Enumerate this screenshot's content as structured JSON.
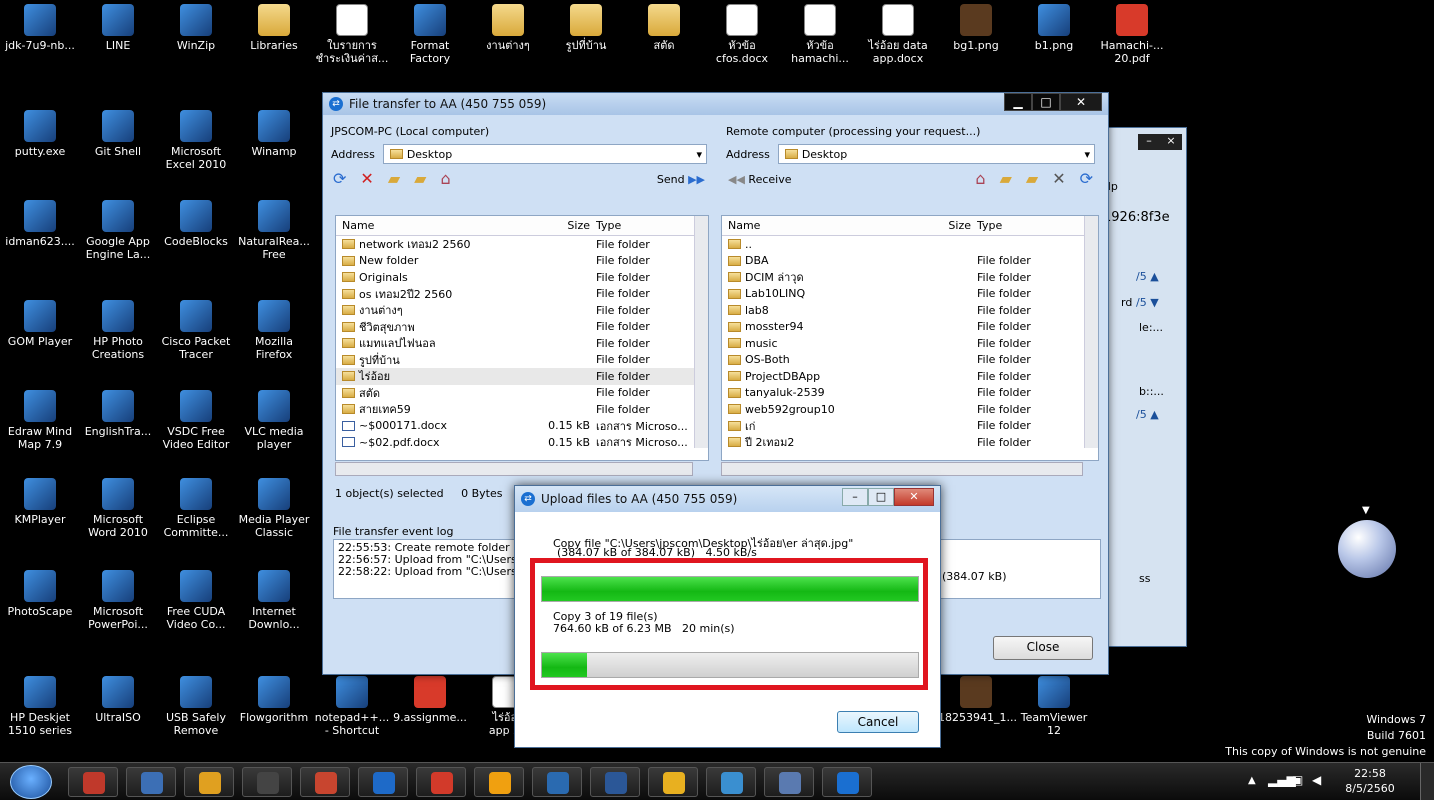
{
  "desktop_icons": [
    {
      "label": "jdk-7u9-nb...",
      "icon": "jdk-installer-icon",
      "kind": "app"
    },
    {
      "label": "LINE",
      "icon": "line-icon",
      "kind": "app"
    },
    {
      "label": "WinZip",
      "icon": "winzip-icon",
      "kind": "app"
    },
    {
      "label": "Libraries",
      "icon": "libraries-icon",
      "kind": "folder"
    },
    {
      "label": "ใบรายการ\nชำระเงินค่าส...",
      "icon": "document-shortcut-icon",
      "kind": "doc"
    },
    {
      "label": "Format\nFactory",
      "icon": "format-factory-icon",
      "kind": "app"
    },
    {
      "label": "งานต่างๆ",
      "icon": "folder-icon",
      "kind": "folder"
    },
    {
      "label": "รูปที่บ้าน",
      "icon": "folder-icon",
      "kind": "folder"
    },
    {
      "label": "สตัด",
      "icon": "folder-icon",
      "kind": "folder"
    },
    {
      "label": "หัวข้อ\ncfos.docx",
      "icon": "word-doc-icon",
      "kind": "doc"
    },
    {
      "label": "หัวข้อ\nhamachi...",
      "icon": "word-doc-icon",
      "kind": "doc"
    },
    {
      "label": "ไร่อ้อย data\napp.docx",
      "icon": "word-doc-icon",
      "kind": "doc"
    },
    {
      "label": "bg1.png",
      "icon": "image-file-icon",
      "kind": "img"
    },
    {
      "label": "b1.png",
      "icon": "image-file-icon",
      "kind": "app"
    },
    {
      "label": "Hamachi-...\n20.pdf",
      "icon": "pdf-file-icon",
      "kind": "pdf"
    },
    {
      "label": "putty.exe",
      "icon": "putty-icon",
      "kind": "app"
    },
    {
      "label": "Git Shell",
      "icon": "git-shell-icon",
      "kind": "app"
    },
    {
      "label": "Microsoft\nExcel 2010",
      "icon": "excel-icon",
      "kind": "app"
    },
    {
      "label": "Winamp",
      "icon": "winamp-icon",
      "kind": "app"
    },
    {
      "label": "idman623....",
      "icon": "idm-icon",
      "kind": "app"
    },
    {
      "label": "Google App\nEngine La...",
      "icon": "google-app-engine-icon",
      "kind": "app"
    },
    {
      "label": "CodeBlocks",
      "icon": "codeblocks-icon",
      "kind": "app"
    },
    {
      "label": "NaturalRea...\nFree",
      "icon": "naturalreader-icon",
      "kind": "app"
    },
    {
      "label": "GOM Player",
      "icon": "gom-player-icon",
      "kind": "app"
    },
    {
      "label": "HP Photo\nCreations",
      "icon": "hp-photo-icon",
      "kind": "app"
    },
    {
      "label": "Cisco Packet\nTracer",
      "icon": "cisco-packet-tracer-icon",
      "kind": "app"
    },
    {
      "label": "Mozilla\nFirefox",
      "icon": "firefox-icon",
      "kind": "app"
    },
    {
      "label": "Edraw Mind\nMap 7.9",
      "icon": "edraw-icon",
      "kind": "app"
    },
    {
      "label": "EnglishTra...",
      "icon": "englishtranslator-icon",
      "kind": "app"
    },
    {
      "label": "VSDC Free\nVideo Editor",
      "icon": "vsdc-icon",
      "kind": "app"
    },
    {
      "label": "VLC media\nplayer",
      "icon": "vlc-icon",
      "kind": "app"
    },
    {
      "label": "KMPlayer",
      "icon": "kmplayer-icon",
      "kind": "app"
    },
    {
      "label": "Microsoft\nWord 2010",
      "icon": "word-icon",
      "kind": "app"
    },
    {
      "label": "Eclipse\nCommitte...",
      "icon": "eclipse-icon",
      "kind": "app"
    },
    {
      "label": "Media Player\nClassic",
      "icon": "media-player-classic-icon",
      "kind": "app"
    },
    {
      "label": "PhotoScape",
      "icon": "photoscape-icon",
      "kind": "app"
    },
    {
      "label": "Microsoft\nPowerPoi...",
      "icon": "powerpoint-icon",
      "kind": "app"
    },
    {
      "label": "Free CUDA\nVideo Co...",
      "icon": "cuda-video-icon",
      "kind": "app"
    },
    {
      "label": "Internet\nDownlo...",
      "icon": "internet-download-icon",
      "kind": "app"
    },
    {
      "label": "HP Deskjet\n1510 series",
      "icon": "printer-icon",
      "kind": "app"
    },
    {
      "label": "UltraISO",
      "icon": "ultraiso-icon",
      "kind": "app"
    },
    {
      "label": "USB Safely\nRemove",
      "icon": "usb-icon",
      "kind": "app"
    },
    {
      "label": "Flowgorithm",
      "icon": "flowgorithm-icon",
      "kind": "app"
    },
    {
      "label": "notepad++...\n- Shortcut",
      "icon": "notepadpp-icon",
      "kind": "app"
    },
    {
      "label": "9.assignme...",
      "icon": "pdf-file-icon",
      "kind": "pdf"
    },
    {
      "label": "ไร่อ้อย\napp 25",
      "icon": "word-doc-icon",
      "kind": "doc"
    },
    {
      "label": "18253941_1...",
      "icon": "image-file-icon",
      "kind": "img"
    },
    {
      "label": "TeamViewer\n12",
      "icon": "teamviewer-icon",
      "kind": "app"
    }
  ],
  "file_transfer": {
    "title": "File transfer to AA (450 755 059)",
    "local": {
      "heading": "JPSCOM-PC (Local computer)",
      "address_label": "Address",
      "address_value": "Desktop",
      "send_label": "Send",
      "col_name": "Name",
      "col_size": "Size",
      "col_type": "Type",
      "files": [
        {
          "name": "network เทอม2 2560",
          "size": "",
          "type": "File folder"
        },
        {
          "name": "New folder",
          "size": "",
          "type": "File folder"
        },
        {
          "name": "Originals",
          "size": "",
          "type": "File folder"
        },
        {
          "name": "os เทอม2ปี2  2560",
          "size": "",
          "type": "File folder"
        },
        {
          "name": "งานต่างๆ",
          "size": "",
          "type": "File folder"
        },
        {
          "name": "ชีวิตสุขภาพ",
          "size": "",
          "type": "File folder"
        },
        {
          "name": "แมทแลปไฟนอล",
          "size": "",
          "type": "File folder"
        },
        {
          "name": "รูปที่บ้าน",
          "size": "",
          "type": "File folder"
        },
        {
          "name": "ไร่อ้อย",
          "size": "",
          "type": "File folder"
        },
        {
          "name": "สตัด",
          "size": "",
          "type": "File folder"
        },
        {
          "name": "สายเทค59",
          "size": "",
          "type": "File folder"
        },
        {
          "name": "~$000171.docx",
          "size": "0.15 kB",
          "type": "เอกสาร Microso..."
        },
        {
          "name": "~$02.pdf.docx",
          "size": "0.15 kB",
          "type": "เอกสาร Microso..."
        }
      ],
      "status": "1 object(s) selected     0 Bytes"
    },
    "remote": {
      "heading": "Remote computer (processing your request...)",
      "address_label": "Address",
      "address_value": "Desktop",
      "receive_label": "Receive",
      "col_name": "Name",
      "col_size": "Size",
      "col_type": "Type",
      "files": [
        {
          "name": "..",
          "size": "",
          "type": ""
        },
        {
          "name": "DBA",
          "size": "",
          "type": "File folder"
        },
        {
          "name": "DCIM ล่าวุด",
          "size": "",
          "type": "File folder"
        },
        {
          "name": "Lab10LINQ",
          "size": "",
          "type": "File folder"
        },
        {
          "name": "lab8",
          "size": "",
          "type": "File folder"
        },
        {
          "name": "mosster94",
          "size": "",
          "type": "File folder"
        },
        {
          "name": "music",
          "size": "",
          "type": "File folder"
        },
        {
          "name": "OS-Both",
          "size": "",
          "type": "File folder"
        },
        {
          "name": "ProjectDBApp",
          "size": "",
          "type": "File folder"
        },
        {
          "name": "tanyaluk-2539",
          "size": "",
          "type": "File folder"
        },
        {
          "name": "web592group10",
          "size": "",
          "type": "File folder"
        },
        {
          "name": "เก่",
          "size": "",
          "type": "File folder"
        },
        {
          "name": "ปี 2เทอม2",
          "size": "",
          "type": "File folder"
        }
      ]
    },
    "event_log_label": "File transfer event log",
    "log_lines": [
      "22:55:53: Create remote folder \"C",
      "22:56:57: Upload from \"C:\\Users\\j",
      "22:58:22: Upload from \"C:\\Users\\j"
    ],
    "log_size": "(384.07 kB)",
    "close_label": "Close"
  },
  "upload": {
    "title": "Upload files to AA (450 755 059)",
    "copy_file": "Copy file \"C:\\Users\\jpscom\\Desktop\\ไร่อ้อย\\er ล่าสุด.jpg\"",
    "file_progress": "(384.07 kB of 384.07 kB)   4.50 kB/s",
    "file_fraction": 1.0,
    "copy_count": "Copy 3 of 19 file(s)",
    "total_progress": "764.60 kB of 6.23 MB   20 min(s)",
    "total_fraction": 0.12,
    "cancel_label": "Cancel",
    "highlight_color": "#e0151f"
  },
  "bg_window": {
    "text_1": "elp",
    "text_2": "1926:8f3e",
    "text_3": "/5 ▲",
    "text_4": "rd",
    "text_5": "/5 ▼",
    "text_6": "le:...",
    "text_7": "b::...",
    "text_8": "/5 ▲",
    "text_9": "ss"
  },
  "watermark": {
    "line1": "Windows 7",
    "line2": "Build 7601",
    "line3": "This copy of Windows is not genuine"
  },
  "clock": {
    "time": "22:58",
    "date": "8/5/2560"
  },
  "taskbar_items": [
    "start-orb-icon",
    "acrobat-icon",
    "blue-app-icon",
    "paint-icon",
    "kmplayer-icon",
    "powerpoint-icon",
    "ie-icon",
    "codeblocks-icon",
    "gom-player-icon",
    "file-manager-icon",
    "word-icon",
    "chrome-icon",
    "windows-media-icon",
    "tool-icon",
    "teamviewer-icon"
  ]
}
